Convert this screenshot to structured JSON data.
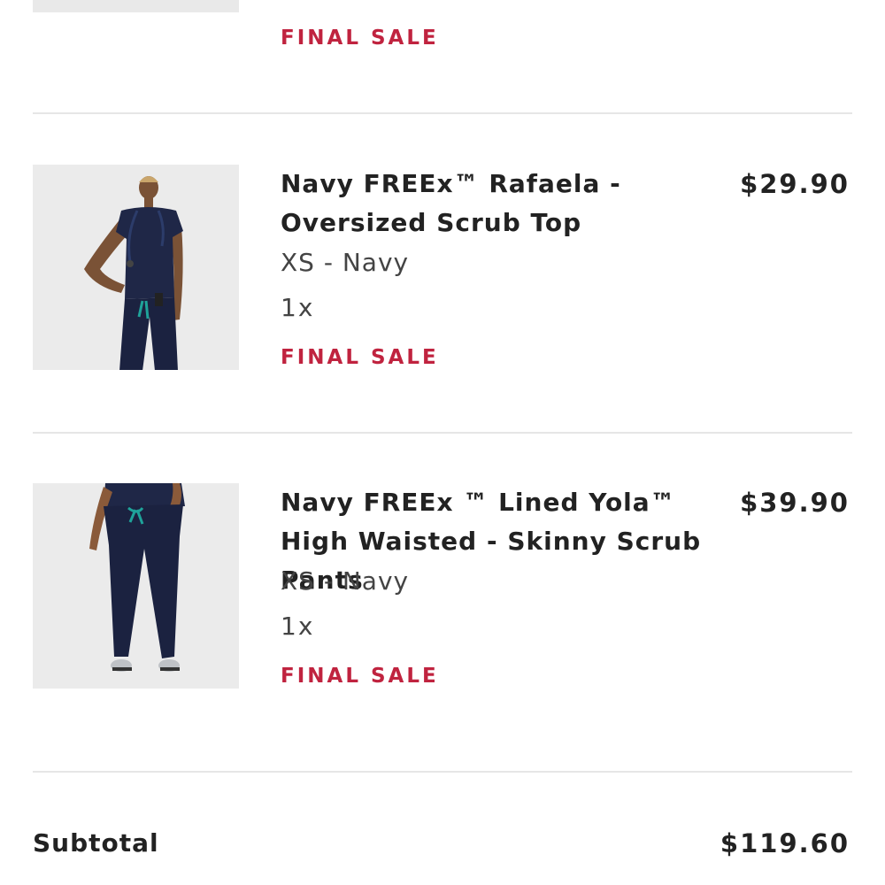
{
  "cart": {
    "previous_item": {
      "badge": "FINAL SALE"
    },
    "items": [
      {
        "name": "Navy FREEx™ Rafaela - Oversized Scrub Top",
        "price": "$29.90",
        "variant": "XS - Navy",
        "quantity": "1x",
        "badge": "FINAL SALE"
      },
      {
        "name": "Navy FREEx ™ Lined Yola™ High Waisted - Skinny Scrub Pants",
        "price": "$39.90",
        "variant": "XS - Navy",
        "quantity": "1x",
        "badge": "FINAL SALE"
      }
    ],
    "summary": {
      "subtotal_label": "Subtotal",
      "subtotal_value": "$119.60"
    }
  },
  "colors": {
    "final_sale": "#c0233f",
    "text": "#222222",
    "product_navy": "#1f2747",
    "thumbnail_bg": "#e9e9e9"
  }
}
